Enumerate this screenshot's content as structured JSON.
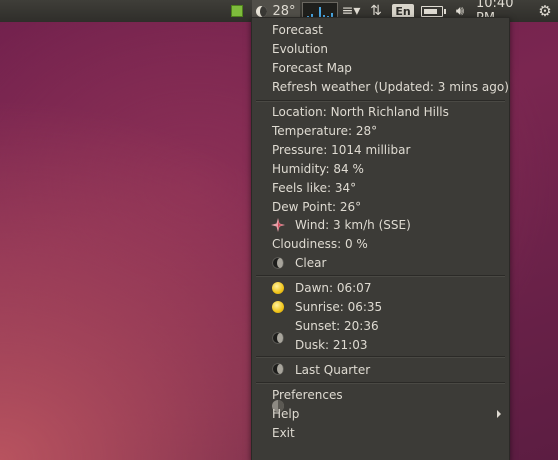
{
  "panel": {
    "temperature": "28°",
    "keyboard": "En",
    "clock": "10:40 PM"
  },
  "menu": {
    "top_items": [
      "Forecast",
      "Evolution",
      "Forecast Map",
      "Refresh weather (Updated: 3 mins ago)"
    ],
    "details": {
      "location": "Location: North Richland Hills",
      "temperature": "Temperature: 28°",
      "pressure": "Pressure: 1014 millibar",
      "humidity": "Humidity: 84 %",
      "feels_like": "Feels like: 34°",
      "dew_point": "Dew Point: 26°",
      "wind": "Wind: 3 km/h (SSE)",
      "cloudiness": "Cloudiness: 0 %",
      "condition": "Clear"
    },
    "sun": {
      "dawn": "Dawn: 06:07",
      "sunrise": "Sunrise: 06:35",
      "sunset": "Sunset: 20:36",
      "dusk": "Dusk: 21:03"
    },
    "moon_phase": "Last Quarter",
    "bottom_items": [
      "Preferences",
      "Help",
      "Exit"
    ]
  },
  "colors": {
    "panel_bg": "#3a3935",
    "menu_bg": "#3c3b37",
    "menu_text": "#dfdbd2",
    "accent_graph": "#4aa7e3"
  }
}
